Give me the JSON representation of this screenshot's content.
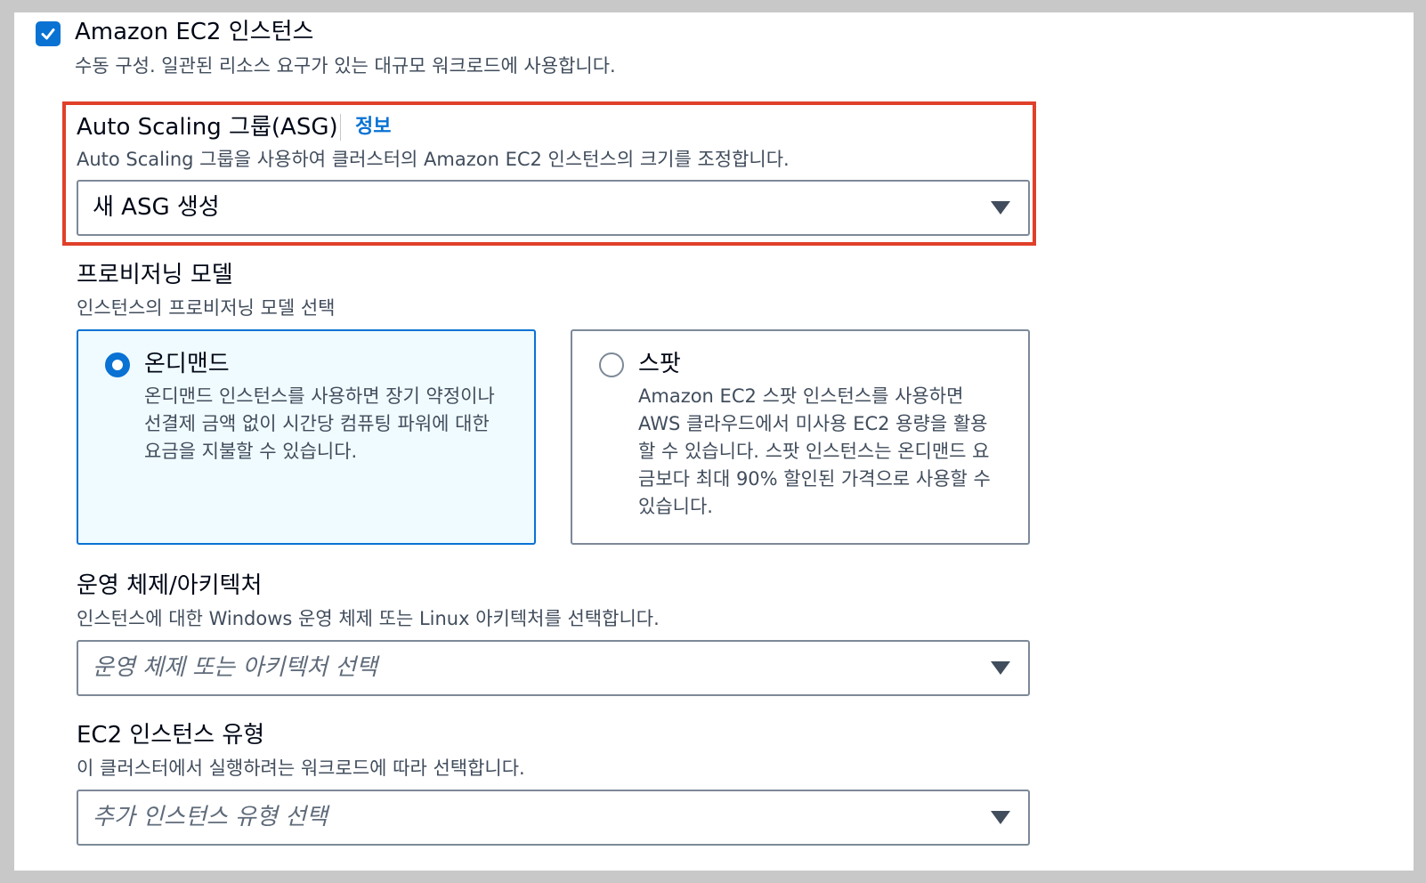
{
  "ec2": {
    "title": "Amazon EC2 인스턴스",
    "description": "수동 구성. 일관된 리소스 요구가 있는 대규모 워크로드에 사용합니다.",
    "checked": true
  },
  "asg": {
    "label": "Auto Scaling 그룹(ASG)",
    "info_link": "정보",
    "description": "Auto Scaling 그룹을 사용하여 클러스터의 Amazon EC2 인스턴스의 크기를 조정합니다.",
    "selected_value": "새 ASG 생성"
  },
  "provisioning": {
    "label": "프로비저닝 모델",
    "description": "인스턴스의 프로비저닝 모델 선택",
    "options": [
      {
        "title": "온디맨드",
        "description": "온디맨드 인스턴스를 사용하면 장기 약정이나 선결제 금액 없이 시간당 컴퓨팅 파워에 대한 요금을 지불할 수 있습니다.",
        "selected": true
      },
      {
        "title": "스팟",
        "description": "Amazon EC2 스팟 인스턴스를 사용하면 AWS 클라우드에서 미사용 EC2 용량을 활용할 수 있습니다. 스팟 인스턴스는 온디맨드 요금보다 최대 90% 할인된 가격으로 사용할 수 있습니다.",
        "selected": false
      }
    ]
  },
  "os_arch": {
    "label": "운영 체제/아키텍처",
    "description": "인스턴스에 대한 Windows 운영 체제 또는 Linux 아키텍처를 선택합니다.",
    "placeholder": "운영 체제 또는 아키텍처 선택"
  },
  "instance_type": {
    "label": "EC2 인스턴스 유형",
    "description": "이 클러스터에서 실행하려는 워크로드에 따라 선택합니다.",
    "placeholder": "추가 인스턴스 유형 선택"
  },
  "colors": {
    "accent": "#0972d3",
    "highlight_border": "#e0402a",
    "text_secondary": "#414d5c"
  }
}
